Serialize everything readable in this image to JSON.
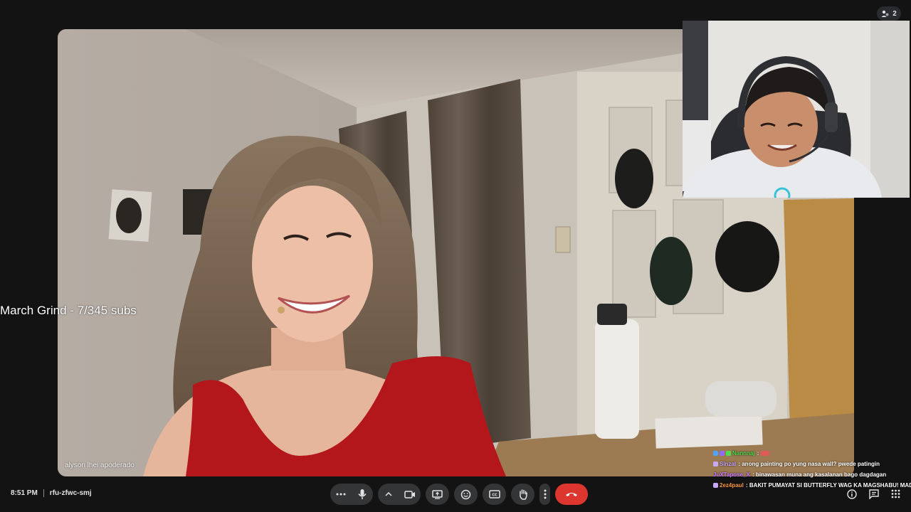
{
  "header": {
    "participant_count": "2"
  },
  "main_tile": {
    "participant_name": "alyson lhei apoderado"
  },
  "stream_overlay": {
    "goal_text": "March Grind - 7/345 subs"
  },
  "chat": {
    "messages": [
      {
        "user": "Nannnaj",
        "text": "",
        "user_color": "#4ddc4d"
      },
      {
        "user": "Sinzal",
        "text": "anong painting po yung nasa wall? pwede patingin",
        "user_color": "#c8a8ff"
      },
      {
        "user": "JuXTapose_X",
        "text": "binawasan muna ang kasalanan bago dagdagan",
        "user_color": "#c87cff"
      },
      {
        "user": "2ez4paul",
        "text": "BAKIT PUMAYAT SI BUTTERFLY WAG KA MAGSHABU! MADA",
        "user_color": "#ff9a3c"
      }
    ]
  },
  "footer": {
    "time": "8:51 PM",
    "meeting_code": "rfu-zfwc-smj"
  },
  "controls": {
    "more_options_icon": "more-horizontal-icon",
    "mic_icon": "mic-icon",
    "camera_icon": "camera-icon",
    "present_icon": "present-screen-icon",
    "reactions_icon": "emoji-icon",
    "captions_icon": "captions-icon",
    "raise_hand_icon": "hand-icon",
    "end_call_icon": "phone-hangup-icon"
  },
  "colors": {
    "background": "#131314",
    "control_button": "#333537",
    "end_call": "#dc362e"
  }
}
